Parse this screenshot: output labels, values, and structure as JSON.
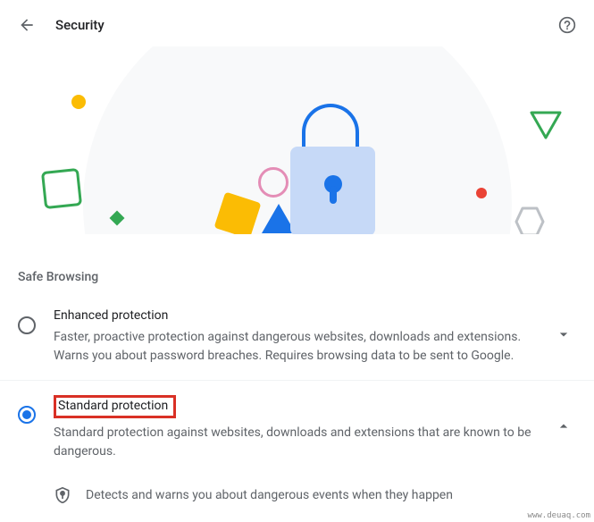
{
  "header": {
    "title": "Security"
  },
  "section": {
    "title": "Safe Browsing"
  },
  "options": [
    {
      "title": "Enhanced protection",
      "description": "Faster, proactive protection against dangerous websites, downloads and extensions. Warns you about password breaches. Requires browsing data to be sent to Google.",
      "selected": false,
      "expanded": false
    },
    {
      "title": "Standard protection",
      "description": "Standard protection against websites, downloads and extensions that are known to be dangerous.",
      "selected": true,
      "expanded": true
    }
  ],
  "details": [
    {
      "text": "Detects and warns you about dangerous events when they happen"
    }
  ],
  "watermark": "www.deuaq.com"
}
